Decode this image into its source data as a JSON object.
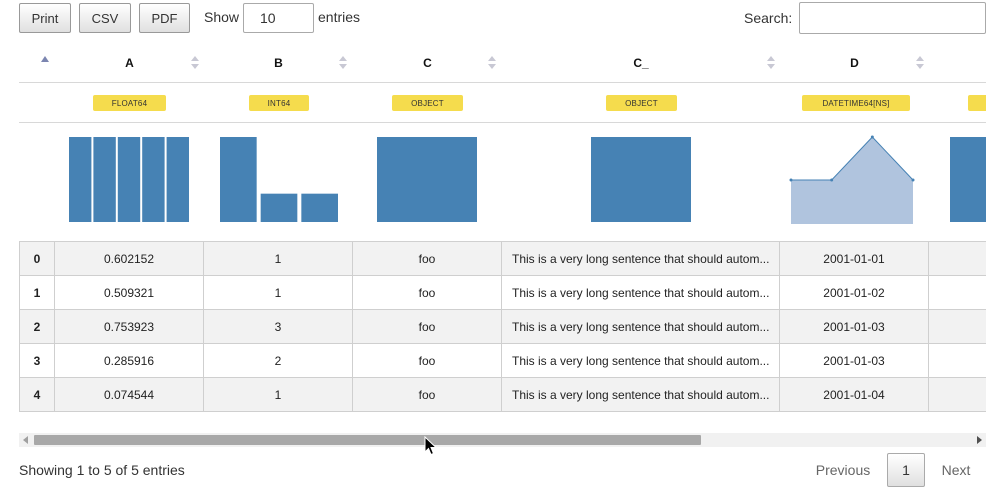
{
  "toolbar": {
    "print_label": "Print",
    "csv_label": "CSV",
    "pdf_label": "PDF",
    "show_label": "Show",
    "show_value": "10",
    "entries_label": "entries",
    "search_label": "Search:",
    "search_value": ""
  },
  "columns": [
    {
      "name": "",
      "dtype": ""
    },
    {
      "name": "A",
      "dtype": "FLOAT64"
    },
    {
      "name": "B",
      "dtype": "INT64"
    },
    {
      "name": "C",
      "dtype": "OBJECT"
    },
    {
      "name": "C_",
      "dtype": "OBJECT"
    },
    {
      "name": "D",
      "dtype": "DATETIME64[NS]"
    }
  ],
  "rows": [
    {
      "index": "0",
      "A": "0.602152",
      "B": "1",
      "C": "foo",
      "C_": "This is a very long sentence that should autom...",
      "D": "2001-01-01"
    },
    {
      "index": "1",
      "A": "0.509321",
      "B": "1",
      "C": "foo",
      "C_": "This is a very long sentence that should autom...",
      "D": "2001-01-02"
    },
    {
      "index": "2",
      "A": "0.753923",
      "B": "3",
      "C": "foo",
      "C_": "This is a very long sentence that should autom...",
      "D": "2001-01-03"
    },
    {
      "index": "3",
      "A": "0.285916",
      "B": "2",
      "C": "foo",
      "C_": "This is a very long sentence that should autom...",
      "D": "2001-01-03"
    },
    {
      "index": "4",
      "A": "0.074544",
      "B": "1",
      "C": "foo",
      "C_": "This is a very long sentence that should autom...",
      "D": "2001-01-04"
    }
  ],
  "histograms": {
    "A": [
      1,
      1,
      1,
      1,
      1
    ],
    "B": [
      3,
      1,
      1
    ],
    "C": [
      1
    ],
    "C_": [
      1
    ],
    "D": [
      1,
      1,
      2,
      1
    ]
  },
  "colors": {
    "bar": "#4682b4",
    "area": "#b0c4de",
    "area_stroke": "#4682b4",
    "dtype_badge": "#f5dc4d"
  },
  "footer": {
    "info": "Showing 1 to 5 of 5 entries",
    "previous_label": "Previous",
    "current_page": "1",
    "next_label": "Next"
  }
}
